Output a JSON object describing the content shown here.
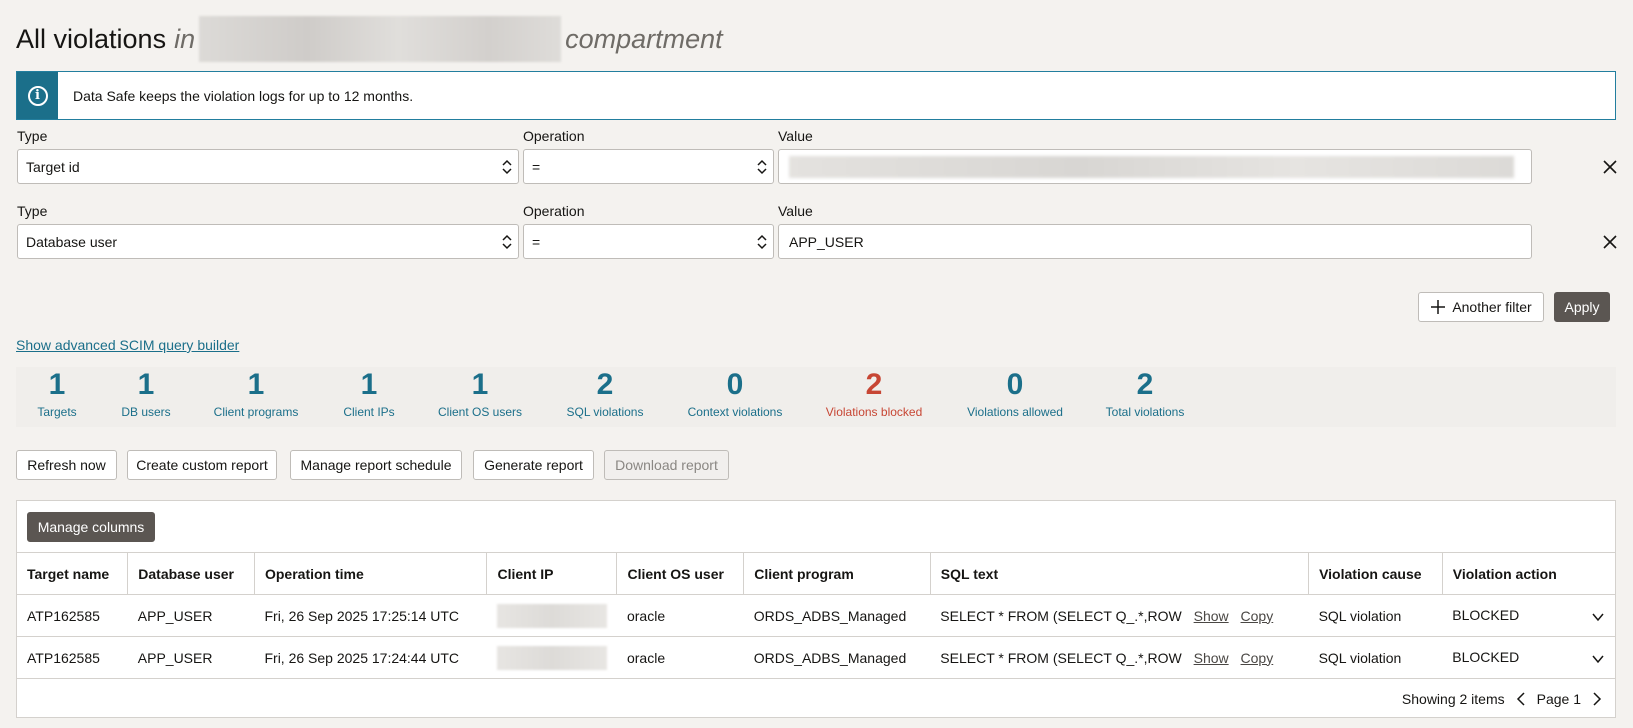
{
  "header": {
    "title": "All violations",
    "in": "in",
    "suffix": "compartment"
  },
  "banner": {
    "icon": "info-icon",
    "message": "Data Safe keeps the violation logs for up to 12 months."
  },
  "filters": [
    {
      "type_label": "Type",
      "type_value": "Target id",
      "op_label": "Operation",
      "op_value": "=",
      "value_label": "Value",
      "value": ""
    },
    {
      "type_label": "Type",
      "type_value": "Database user",
      "op_label": "Operation",
      "op_value": "=",
      "value_label": "Value",
      "value": "APP_USER"
    }
  ],
  "filter_actions": {
    "another_filter": "Another filter",
    "apply": "Apply"
  },
  "scim_link": "Show advanced SCIM query builder",
  "stats": [
    {
      "num": "1",
      "label": "Targets"
    },
    {
      "num": "1",
      "label": "DB users"
    },
    {
      "num": "1",
      "label": "Client programs"
    },
    {
      "num": "1",
      "label": "Client IPs"
    },
    {
      "num": "1",
      "label": "Client OS users"
    },
    {
      "num": "2",
      "label": "SQL violations"
    },
    {
      "num": "0",
      "label": "Context violations"
    },
    {
      "num": "2",
      "label": "Violations blocked"
    },
    {
      "num": "0",
      "label": "Violations allowed"
    },
    {
      "num": "2",
      "label": "Total violations"
    }
  ],
  "toolbar": {
    "refresh": "Refresh now",
    "custom_report": "Create custom report",
    "schedule": "Manage report schedule",
    "generate": "Generate report",
    "download": "Download report"
  },
  "table": {
    "manage_columns": "Manage columns",
    "headers": [
      "Target name",
      "Database user",
      "Operation time",
      "Client IP",
      "Client OS user",
      "Client program",
      "SQL text",
      "Violation cause",
      "Violation action"
    ],
    "rows": [
      {
        "target": "ATP162585",
        "db_user": "APP_USER",
        "time": "Fri, 26 Sep 2025 17:25:14 UTC",
        "os_user": "oracle",
        "program": "ORDS_ADBS_Managed",
        "sql": "SELECT * FROM (SELECT Q_.*,ROW",
        "show": "Show",
        "copy": "Copy",
        "cause": "SQL violation",
        "action": "BLOCKED"
      },
      {
        "target": "ATP162585",
        "db_user": "APP_USER",
        "time": "Fri, 26 Sep 2025 17:24:44 UTC",
        "os_user": "oracle",
        "program": "ORDS_ADBS_Managed",
        "sql": "SELECT * FROM (SELECT Q_.*,ROW",
        "show": "Show",
        "copy": "Copy",
        "cause": "SQL violation",
        "action": "BLOCKED"
      }
    ]
  },
  "pager": {
    "showing": "Showing 2 items",
    "page": "Page 1"
  },
  "colors": {
    "accent": "#1b6f8a",
    "alert": "#c74634",
    "dark_button": "#5b5652"
  }
}
